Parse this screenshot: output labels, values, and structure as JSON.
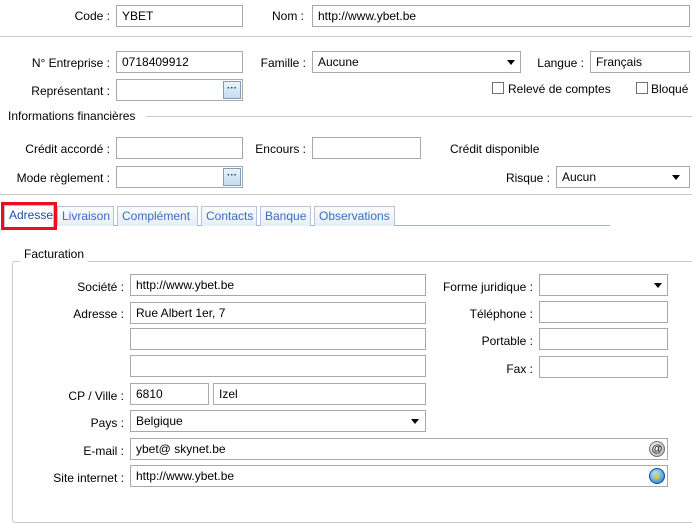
{
  "header": {
    "code_label": "Code :",
    "code_value": "YBET",
    "nom_label": "Nom :",
    "nom_value": "http://www.ybet.be"
  },
  "company": {
    "entreprise_label": "N° Entreprise :",
    "entreprise_value": "0718409912",
    "famille_label": "Famille :",
    "famille_value": "Aucune",
    "langue_label": "Langue :",
    "langue_value": "Français",
    "representant_label": "Représentant :",
    "representant_value": "",
    "releve_label": "Relevé de comptes",
    "bloque_label": "Bloqué"
  },
  "finance": {
    "section_title": "Informations financières",
    "credit_label": "Crédit accordé :",
    "credit_value": "",
    "encours_label": "Encours :",
    "encours_value": "",
    "disponible_label": "Crédit disponible",
    "mode_label": "Mode règlement :",
    "mode_value": "",
    "risque_label": "Risque :",
    "risque_value": "Aucun"
  },
  "tabs": [
    {
      "label": "Adresse",
      "active": true
    },
    {
      "label": "Livraison",
      "active": false
    },
    {
      "label": "Complément",
      "active": false
    },
    {
      "label": "Contacts",
      "active": false
    },
    {
      "label": "Banque",
      "active": false
    },
    {
      "label": "Observations",
      "active": false
    }
  ],
  "facturation": {
    "group_title": "Facturation",
    "societe_label": "Société :",
    "societe_value": "http://www.ybet.be",
    "adresse_label": "Adresse :",
    "adresse_line1": "Rue Albert 1er, 7",
    "adresse_line2": "",
    "adresse_line3": "",
    "cp_label": "CP / Ville :",
    "cp_value": "6810",
    "ville_value": "Izel",
    "pays_label": "Pays :",
    "pays_value": "Belgique",
    "email_label": "E-mail :",
    "email_value": "ybet@ skynet.be",
    "site_label": "Site internet :",
    "site_value": "http://www.ybet.be",
    "forme_label": "Forme juridique :",
    "forme_value": "",
    "tel_label": "Téléphone :",
    "tel_value": "",
    "portable_label": "Portable :",
    "portable_value": "",
    "fax_label": "Fax :",
    "fax_value": ""
  },
  "colors": {
    "highlight": "#e8101a",
    "tab_text": "#3a6cc0"
  }
}
